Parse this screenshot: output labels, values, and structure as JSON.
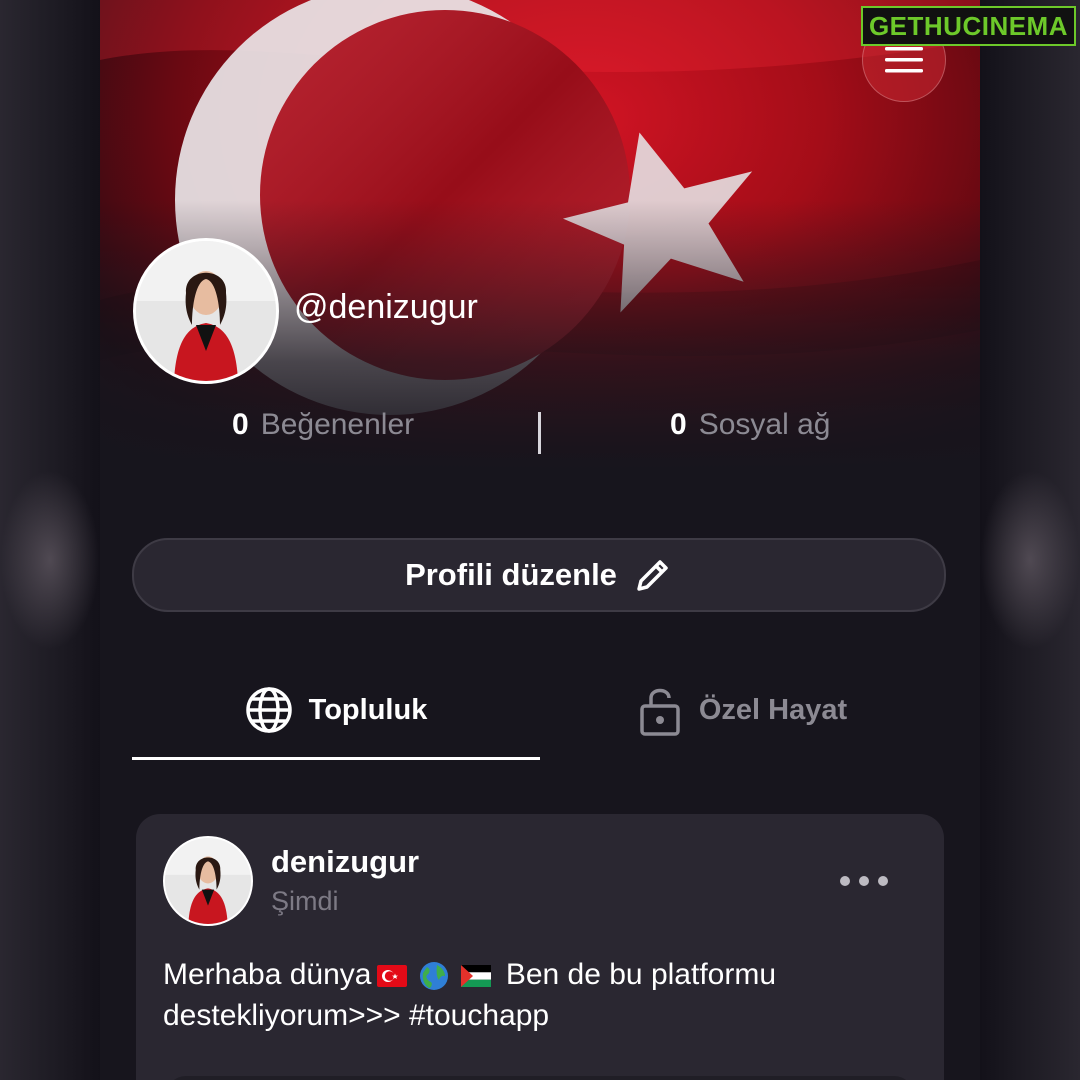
{
  "profile": {
    "handle": "@denizugur",
    "stats": [
      {
        "value": "0",
        "label": "Beğenenler"
      },
      {
        "value": "0",
        "label": "Sosyal ağ"
      }
    ]
  },
  "actions": {
    "edit_profile_label": "Profili düzenle"
  },
  "tabs": [
    {
      "label": "Topluluk",
      "icon": "globe-icon",
      "active": true
    },
    {
      "label": "Özel Hayat",
      "icon": "lock-icon",
      "active": false
    }
  ],
  "post": {
    "author": "denizugur",
    "time": "Şimdi",
    "text_line1_prefix": "Merhaba dünya",
    "text_line1_suffix": "Ben de bu platformu",
    "text_line2": "destekliyorum>>> #touchapp"
  },
  "watermark": {
    "part1": "GETHU",
    "part2": "CINEMA"
  },
  "colors": {
    "accent_red": "#d11424",
    "background": "#17151d",
    "card": "#2a2731",
    "muted_text": "#8c8a93"
  }
}
